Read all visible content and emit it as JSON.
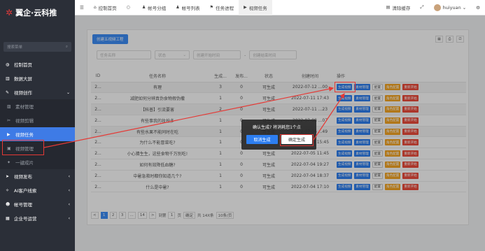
{
  "app": {
    "logo_text": "翼企·云科推",
    "logo_mark": "✲"
  },
  "sidebar": {
    "search_placeholder": "搜索菜单",
    "items": [
      {
        "label": "控制首页",
        "icon": "dashboard-icon",
        "type": "group"
      },
      {
        "label": "数据大屏",
        "icon": "chart-icon",
        "type": "group"
      },
      {
        "label": "视频创作",
        "icon": "edit-icon",
        "type": "group",
        "arrow": "⌄"
      },
      {
        "label": "素材管理",
        "icon": "image-icon",
        "type": "sub"
      },
      {
        "label": "视频剪辑",
        "icon": "scissors-icon",
        "type": "sub"
      },
      {
        "label": "视频任务",
        "icon": "video-icon",
        "type": "sub",
        "active": true
      },
      {
        "label": "视频管理",
        "icon": "film-icon",
        "type": "sub"
      },
      {
        "label": "一键成片",
        "icon": "magic-icon",
        "type": "sub"
      },
      {
        "label": "视频发布",
        "icon": "send-icon",
        "type": "group",
        "arrow": "‹"
      },
      {
        "label": "AI客户线索",
        "icon": "ai-icon",
        "type": "group",
        "arrow": "‹"
      },
      {
        "label": "帐号管理",
        "icon": "users-icon",
        "type": "group",
        "arrow": "‹"
      },
      {
        "label": "企业号运营",
        "icon": "org-icon",
        "type": "group",
        "arrow": "‹"
      }
    ]
  },
  "topbar": {
    "menu_icon": "☰",
    "tabs": [
      {
        "label": "控制首页",
        "icon": "home-icon"
      },
      {
        "label": "",
        "icon": "circle-icon"
      },
      {
        "label": "帐号分组",
        "icon": "user-icon"
      },
      {
        "label": "帐号列表",
        "icon": "user-icon"
      },
      {
        "label": "任务进程",
        "icon": "flag-icon"
      },
      {
        "label": "视频任务",
        "icon": "video-icon",
        "active": true
      }
    ],
    "clear_cache": "清除缓存",
    "username": "huiyuan"
  },
  "toolbar": {
    "create_label": "创建五视频工程"
  },
  "filters": {
    "task_name": "任务名称",
    "status": "状态",
    "start_date": "创建开始时间",
    "separator": "-",
    "end_date": "创建结束时间"
  },
  "table": {
    "columns": [
      "ID",
      "任务名称",
      "生成...",
      "发布...",
      "状态",
      "创建时间",
      "操作"
    ],
    "rows": [
      {
        "id": "2...",
        "name": "有理",
        "gen": "3",
        "pub": "0",
        "status": "可生成",
        "time": "2022-07-12 ...00",
        "alt": true
      },
      {
        "id": "2...",
        "name": "减肥如何分辨真伪食物假伪撒",
        "gen": "1",
        "pub": "0",
        "status": "可生成",
        "time": "2022-07-11 17:43",
        "alt": false
      },
      {
        "id": "2...",
        "name": "【科普】引流要害",
        "gen": "2",
        "pub": "0",
        "status": "可生成",
        "time": "2022-07-11 ...23",
        "alt": true
      },
      {
        "id": "2...",
        "name": "有些事我的妆扮多",
        "gen": "1",
        "pub": "0",
        "status": "可生成",
        "time": "2022-07-08 ...07",
        "alt": false
      },
      {
        "id": "2...",
        "name": "有些水果不能同时在吃",
        "gen": "1",
        "pub": "0",
        "status": "可生成",
        "time": "2022-07-06 ...49",
        "alt": true
      },
      {
        "id": "2...",
        "name": "为什么不能冒菜吃?",
        "gen": "1",
        "pub": "0",
        "status": "可生成",
        "time": "2022-07-05 15:45",
        "alt": false
      },
      {
        "id": "2...",
        "name": "小心猜生生，这些食物千万别吃!",
        "gen": "1",
        "pub": "0",
        "status": "可生成",
        "time": "2022-07-05 11:45",
        "alt": false
      },
      {
        "id": "2...",
        "name": "如何有效降低血糖?",
        "gen": "1",
        "pub": "0",
        "status": "可生成",
        "time": "2022-07-04 19:27",
        "alt": false
      },
      {
        "id": "2...",
        "name": "中暑急救时都你知道几个?",
        "gen": "1",
        "pub": "0",
        "status": "可生成",
        "time": "2022-07-04 18:37",
        "alt": false
      },
      {
        "id": "2...",
        "name": "什么是中暑?",
        "gen": "1",
        "pub": "0",
        "status": "可生成",
        "time": "2022-07-04 17:10",
        "alt": false
      }
    ],
    "ops": {
      "gen": "生成视频",
      "mat": "素材管理",
      "cfg": "配置",
      "tpl": "角色配置",
      "rst": "重新开始"
    }
  },
  "pager": {
    "prev": "<",
    "pages": [
      "1",
      "2",
      "3",
      "...",
      "14"
    ],
    "next": ">",
    "goto": "到第",
    "page_value": "1",
    "page_unit": "页",
    "confirm": "确定",
    "total": "共 14X条",
    "per_page": "10条/页"
  },
  "dialog": {
    "message": "确认生成? 将消耗您1个点",
    "cancel": "取消生成",
    "ok": "确定生成"
  },
  "colors": {
    "accent": "#3e8ef7",
    "sidebar_bg": "#2b2f38",
    "active": "#3e7be6",
    "warn": "#f5a623",
    "danger": "#ee4b3b",
    "highlight": "#e53935"
  }
}
